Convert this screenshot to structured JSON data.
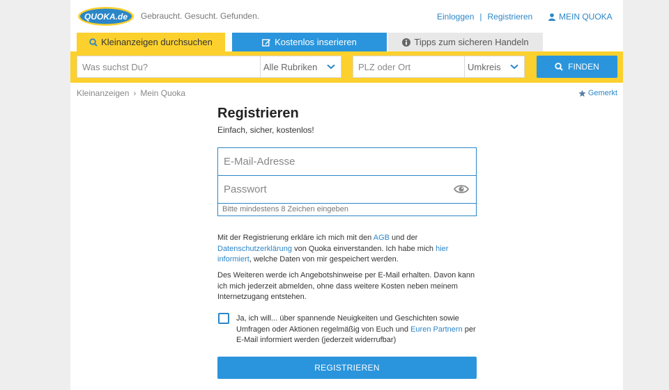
{
  "header": {
    "logo_text": "QUOKA.de",
    "tagline": "Gebraucht. Gesucht. Gefunden.",
    "login_label": "Einloggen",
    "separator": "|",
    "register_label": "Registrieren",
    "mein_quoka_label": "MEIN QUOKA"
  },
  "tabs": [
    {
      "label": "Kleinanzeigen durchsuchen",
      "icon": "search-icon"
    },
    {
      "label": "Kostenlos inserieren",
      "icon": "edit-icon"
    },
    {
      "label": "Tipps zum sicheren Handeln",
      "icon": "info-icon"
    }
  ],
  "search": {
    "what_placeholder": "Was suchst Du?",
    "category_value": "Alle Rubriken",
    "location_placeholder": "PLZ oder Ort",
    "radius_value": "Umkreis",
    "find_label": "FINDEN"
  },
  "breadcrumb": {
    "items": [
      "Kleinanzeigen",
      "Mein Quoka"
    ],
    "separator": "›"
  },
  "bookmark_label": "Gemerkt",
  "form": {
    "title": "Registrieren",
    "subtitle": "Einfach, sicher, kostenlos!",
    "email_placeholder": "E-Mail-Adresse",
    "password_placeholder": "Passwort",
    "password_hint": "Bitte mindestens 8 Zeichen eingeben",
    "legal": {
      "t1": "Mit der Registrierung erkläre ich mich mit den ",
      "agb": "AGB",
      "t2": " und der ",
      "privacy": "Datenschutzerklärung",
      "t3": " von Quoka einverstanden. Ich habe mich ",
      "here": "hier informiert",
      "t4": ", welche Daten von mir gespeichert werden."
    },
    "offers_text": "Des Weiteren werde ich Angebotshinweise per E-Mail erhalten. Davon kann ich mich jederzeit abmelden, ohne dass weitere Kosten neben meinem Internetzugang entstehen.",
    "newsletter": {
      "t1": "Ja, ich will... über spannende Neuigkeiten und Geschichten sowie Umfragen oder Aktionen regelmäßig von Euch und ",
      "partners": "Euren Partnern",
      "t2": " per E-Mail informiert werden (jederzeit widerrufbar)",
      "checked": false
    },
    "submit_label": "REGISTRIEREN"
  },
  "colors": {
    "brand_yellow": "#fcd02d",
    "brand_blue": "#2a95dc",
    "link_blue": "#2a86c8"
  }
}
